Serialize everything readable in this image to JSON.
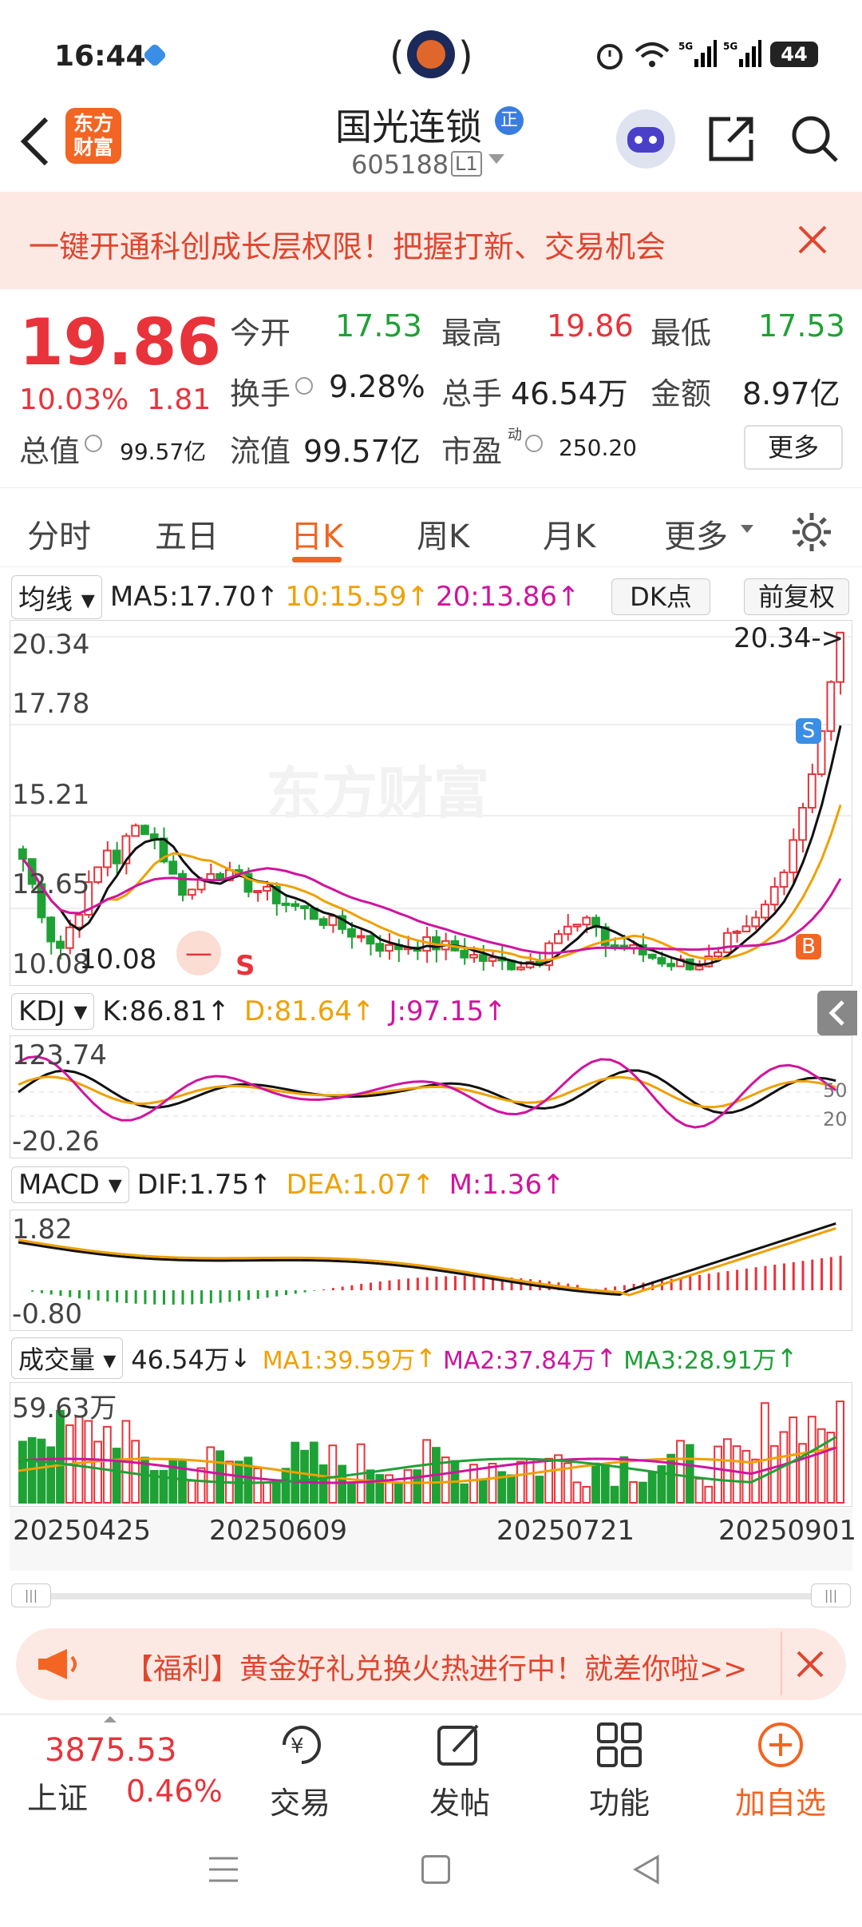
{
  "status": {
    "time": "16:44",
    "battery": "44"
  },
  "stock": {
    "name": "国光连锁",
    "badge": "正",
    "code": "605188",
    "level": "L1"
  },
  "banner": {
    "text": "一键开通科创成长层权限！把握打新、交易机会"
  },
  "quote": {
    "price": "19.86",
    "change_pct": "10.03%",
    "change": "1.81",
    "open_label": "今开",
    "open": "17.53",
    "high_label": "最高",
    "high": "19.86",
    "low_label": "最低",
    "low": "17.53",
    "turnover_label": "换手",
    "turnover": "9.28%",
    "volume_label": "总手",
    "volume": "46.54万",
    "amount_label": "金额",
    "amount": "8.97亿",
    "mktcap_label": "总值",
    "mktcap": "99.57亿",
    "float_label": "流值",
    "float": "99.57亿",
    "pe_label": "市盈",
    "pe_sup": "动",
    "pe": "250.20",
    "more_label": "更多"
  },
  "tabs": [
    "分时",
    "五日",
    "日K",
    "周K",
    "月K",
    "更多"
  ],
  "active_tab": "日K",
  "ma_bar": {
    "selector": "均线",
    "ma5": "MA5:17.70",
    "ma10": "10:15.59",
    "ma20": "20:13.86",
    "dk": "DK点",
    "adjust": "前复权"
  },
  "price_axis": [
    "20.34",
    "17.78",
    "15.21",
    "12.65",
    "10.08"
  ],
  "price_annotations": {
    "high_marker": "20.34->",
    "low_marker": "10.08",
    "sell": "S",
    "buy": "B",
    "watermark": "东方财富"
  },
  "kdj_bar": {
    "selector": "KDJ",
    "k": "K:86.81",
    "d": "D:81.64",
    "j": "J:97.15"
  },
  "kdj_axis": {
    "top": "123.74",
    "bottom": "-20.26",
    "l50": "50",
    "l20": "20"
  },
  "macd_bar": {
    "selector": "MACD",
    "dif": "DIF:1.75",
    "dea": "DEA:1.07",
    "m": "M:1.36"
  },
  "macd_axis": {
    "top": "1.82",
    "bottom": "-0.80"
  },
  "vol_bar": {
    "selector": "成交量",
    "vol": "46.54万",
    "ma1": "MA1:39.59万",
    "ma2": "MA2:37.84万",
    "ma3": "MA3:28.91万"
  },
  "vol_axis": {
    "top": "59.63万"
  },
  "dates": [
    "20250425",
    "20250609",
    "20250721",
    "20250901"
  ],
  "promo": {
    "text": "【福利】黄金好礼兑换火热进行中！就差你啦>>"
  },
  "index": {
    "value": "3875.53",
    "name": "上证",
    "pct": "0.46%"
  },
  "nav": [
    "交易",
    "发帖",
    "功能",
    "加自选"
  ],
  "colors": {
    "up": "#e8333a",
    "down": "#1ea135",
    "ma10": "#f0a000",
    "ma20": "#d0149e",
    "accent": "#f26522"
  }
}
